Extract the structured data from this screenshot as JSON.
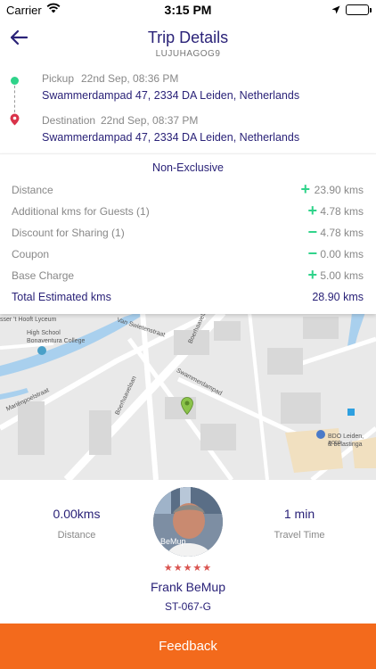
{
  "status_bar": {
    "carrier": "Carrier",
    "time": "3:15 PM"
  },
  "header": {
    "title": "Trip Details",
    "trip_code": "LUJUHAGOG9"
  },
  "route": {
    "pickup": {
      "label": "Pickup",
      "time": "22nd Sep, 08:36 PM",
      "address": "Swammerdampad 47, 2334 DA Leiden, Netherlands"
    },
    "destination": {
      "label": "Destination",
      "time": "22nd Sep, 08:37 PM",
      "address": "Swammerdampad 47, 2334 DA Leiden, Netherlands"
    }
  },
  "fare": {
    "title": "Non-Exclusive",
    "rows": [
      {
        "label": "Distance",
        "sign": "+",
        "value": "23.90 kms"
      },
      {
        "label": "Additional kms for Guests (1)",
        "sign": "+",
        "value": "4.78 kms"
      },
      {
        "label": "Discount for Sharing (1)",
        "sign": "−",
        "value": "4.78 kms"
      },
      {
        "label": "Coupon",
        "sign": "−",
        "value": "0.00 kms"
      },
      {
        "label": "Base Charge",
        "sign": "+",
        "value": "5.00 kms"
      }
    ],
    "total": {
      "label": "Total Estimated kms",
      "value": "28.90 kms"
    }
  },
  "map": {
    "labels": [
      "sser 't Hooft Lyceum",
      "High School",
      "Bonaventura College",
      "Van Swietenstraat",
      "Boerhaavelaan",
      "Swammerdampad",
      "Mariënpoelstraat",
      "Boerhaavelaan",
      "BDO Leiden, acco",
      "& belastinga"
    ]
  },
  "driver": {
    "distance_value": "0.00kms",
    "distance_label": "Distance",
    "time_value": "1 min",
    "time_label": "Travel Time",
    "stars": "★★★★★",
    "name": "Frank BeMup",
    "plate": "ST-067-G"
  },
  "footer": {
    "feedback_label": "Feedback"
  },
  "colors": {
    "accent": "#2a2278",
    "positive": "#2fd38a",
    "orange": "#f36a1c"
  },
  "icons": {
    "back": "arrow-left",
    "wifi": "wifi",
    "location": "location-arrow",
    "pickup": "green-dot",
    "destination": "red-pin"
  }
}
